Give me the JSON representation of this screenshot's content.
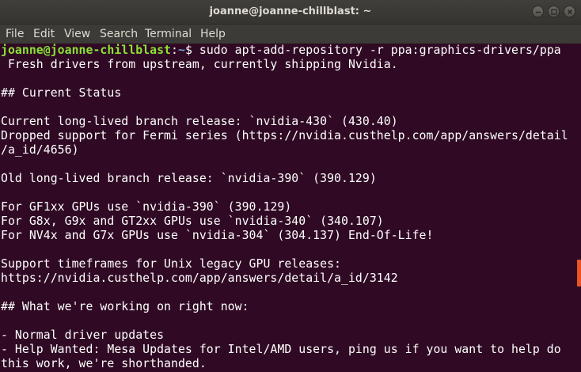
{
  "window": {
    "title": "joanne@joanne-chillblast: ~"
  },
  "menu": {
    "items": [
      "File",
      "Edit",
      "View",
      "Search",
      "Terminal",
      "Help"
    ]
  },
  "prompt": {
    "user_host": "joanne@joanne-chillblast",
    "colon": ":",
    "path": "~",
    "symbol": "$",
    "command": " sudo apt-add-repository -r ppa:graphics-drivers/ppa"
  },
  "output": [
    " Fresh drivers from upstream, currently shipping Nvidia.",
    "",
    "## Current Status",
    "",
    "Current long-lived branch release: `nvidia-430` (430.40)",
    "Dropped support for Fermi series (https://nvidia.custhelp.com/app/answers/detail",
    "/a_id/4656)",
    "",
    "Old long-lived branch release: `nvidia-390` (390.129)",
    "",
    "For GF1xx GPUs use `nvidia-390` (390.129)",
    "For G8x, G9x and GT2xx GPUs use `nvidia-340` (340.107)",
    "For NV4x and G7x GPUs use `nvidia-304` (304.137) End-Of-Life!",
    "",
    "Support timeframes for Unix legacy GPU releases:",
    "https://nvidia.custhelp.com/app/answers/detail/a_id/3142",
    "",
    "## What we're working on right now:",
    "",
    "- Normal driver updates",
    "- Help Wanted: Mesa Updates for Intel/AMD users, ping us if you want to help do",
    "this work, we're shorthanded."
  ],
  "colors": {
    "terminal_bg": "#300a24",
    "prompt_user": "#8ae234",
    "prompt_path": "#729fcf",
    "scrollbar_thumb": "#e95420"
  },
  "icons": {
    "minimize": "minimize-icon",
    "maximize": "maximize-icon",
    "close": "close-icon"
  }
}
